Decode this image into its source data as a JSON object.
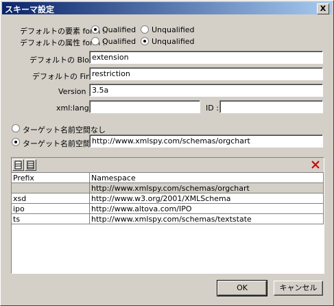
{
  "window": {
    "title": "スキーマ設定",
    "close_label": "X"
  },
  "element_form": {
    "label": "デフォルトの要素 form :",
    "options": [
      "Qualified",
      "Unqualified"
    ],
    "selected": "Qualified"
  },
  "attribute_form": {
    "label": "デフォルトの属性 form :",
    "options": [
      "Qualified",
      "Unqualified"
    ],
    "selected": "Unqualified"
  },
  "block": {
    "label": "デフォルトの Block :",
    "value": "extension"
  },
  "final": {
    "label": "デフォルトの Final :",
    "value": "restriction"
  },
  "version": {
    "label": "Version :",
    "value": "3.5a"
  },
  "xml_lang": {
    "label": "xml:lang :",
    "value": ""
  },
  "id": {
    "label": "ID :",
    "value": ""
  },
  "target_ns": {
    "none_label": "ターゲット名前空間なし",
    "ns_label": "ターゲット名前空間",
    "selected": "ns",
    "value": "http://www.xmlspy.com/schemas/orgchart"
  },
  "ns_table": {
    "headers": [
      "Prefix",
      "Namespace"
    ],
    "rows": [
      {
        "prefix": "",
        "namespace": "http://www.xmlspy.com/schemas/orgchart"
      },
      {
        "prefix": "xsd",
        "namespace": "http://www.w3.org/2001/XMLSchema"
      },
      {
        "prefix": "ipo",
        "namespace": "http://www.altova.com/IPO"
      },
      {
        "prefix": "ts",
        "namespace": "http://www.xmlspy.com/schemas/textstate"
      }
    ]
  },
  "buttons": {
    "ok": "OK",
    "cancel": "キャンセル"
  },
  "icons": {
    "add_row": "insert-row-icon",
    "append_row": "append-row-icon",
    "delete": "delete-x-icon"
  },
  "colors": {
    "title_start": "#0a246a",
    "title_end": "#a6caf0",
    "delete": "#cc0000"
  }
}
